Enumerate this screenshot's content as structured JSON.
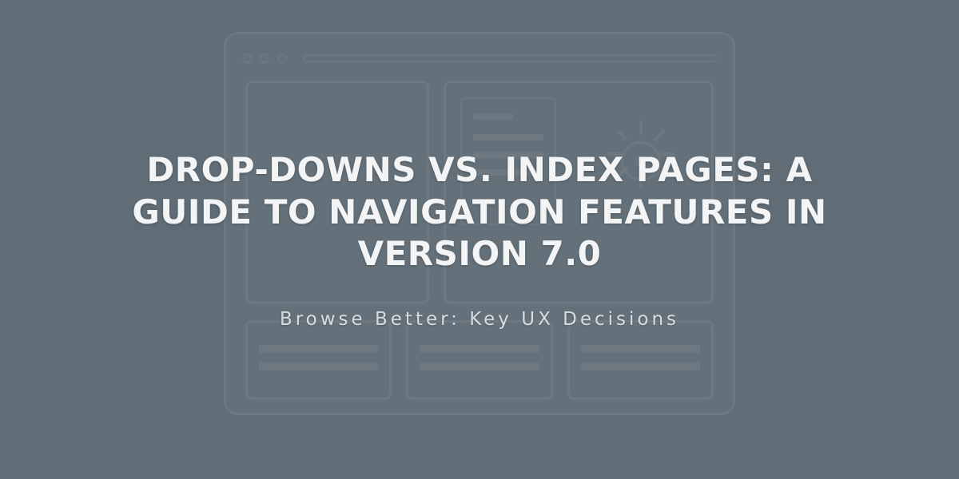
{
  "hero": {
    "title": "DROP-DOWNS VS. INDEX PAGES: A GUIDE TO NAVIGATION FEATURES IN VERSION 7.0",
    "subtitle": "Browse Better: Key UX Decisions"
  }
}
